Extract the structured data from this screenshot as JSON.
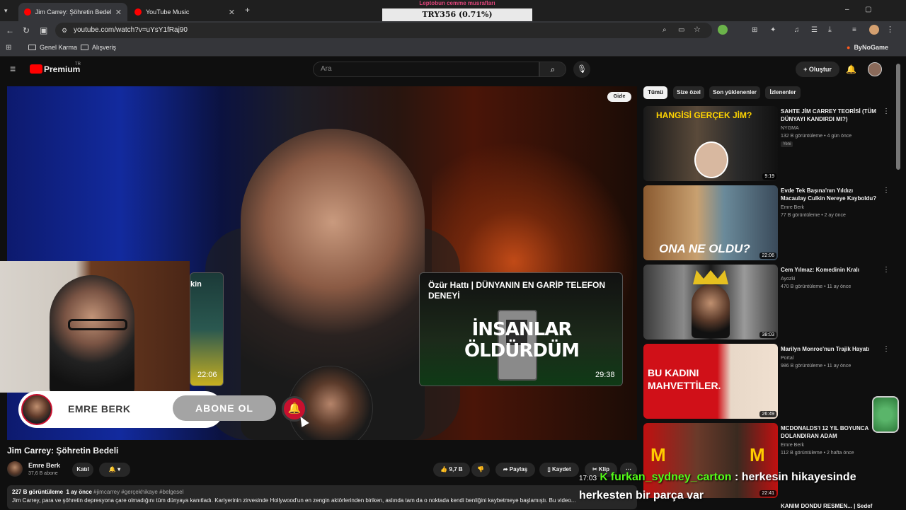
{
  "browser": {
    "tabs": [
      {
        "title": "Jim Carrey: Şöhretin Bedeli - Yo"
      },
      {
        "title": "YouTube Music"
      }
    ],
    "url": "youtube.com/watch?v=uYsY1fRaj90",
    "bookmarks": [
      "Genel Karma",
      "Alışveriş"
    ],
    "extension_label": "ByNoGame"
  },
  "ticker": {
    "header": "Leptobun cemme musrafları",
    "value": "TRY356 (0.71%)"
  },
  "youtube": {
    "logo": "Premium",
    "logo_region": "TR",
    "search_placeholder": "Ara",
    "create_label": "Oluştur"
  },
  "player": {
    "hide_label": "Gizle",
    "endcard_left_title": "kin",
    "endcard_left_duration": "22:06",
    "endcard_right_title": "Özür Hattı | DÜNYANIN EN GARİP TELEFON DENEYİ",
    "endcard_right_text": "İNSANLAR ÖLDÜRDÜM",
    "endcard_right_duration": "29:38",
    "subscribe_channel": "EMRE BERK",
    "subscribe_button": "ABONE OL"
  },
  "video": {
    "title": "Jim Carrey: Şöhretin Bedeli",
    "channel": "Emre Berk",
    "subscribers": "37,6 B abone",
    "join_label": "Katıl",
    "likes": "9,7 B",
    "share_label": "Paylaş",
    "save_label": "Kaydet",
    "clip_label": "Klip",
    "views": "227 B görüntüleme",
    "age": "1 ay önce",
    "hashtags": "#jimcarrey #gerçekhikaye #belgesel",
    "description": "Jim Carrey, para ve şöhretin depresyona çare olmadığını tüm dünyaya kanıtladı. Kariyerinin zirvesinde Hollywood'un en zengin aktörlerinden biriken, aslında tam da o noktada kendi benliğini kaybetmeye başlamıştı. Bu video..."
  },
  "filters": [
    "Tümü",
    "Size özel",
    "Son yüklenenler",
    "İzlenenler"
  ],
  "recommendations": [
    {
      "title": "SAHTE JİM CARREY TEORİSİ (TÜM DÜNYAYI KANDIRDI MI?)",
      "channel": "NYGMA",
      "meta": "132 B görüntüleme • 4 gün önce",
      "badge": "Yeni",
      "duration": "9:19",
      "thumb_text": "HANGİSİ GERÇEK JİM?"
    },
    {
      "title": "Evde Tek Başına'nın Yıldızı Macaulay Culkin Nereye Kayboldu?",
      "channel": "Emre Berk",
      "meta": "77 B görüntüleme • 2 ay önce",
      "duration": "22:06",
      "thumb_text": "ONA NE OLDU?"
    },
    {
      "title": "Cem Yılmaz: Komedinin Kralı",
      "channel": "Ayozki",
      "meta": "470 B görüntüleme • 11 ay önce",
      "duration": "38:03",
      "thumb_text": ""
    },
    {
      "title": "Marilyn Monroe'nun Trajik Hayatı",
      "channel": "Portal",
      "meta": "986 B görüntüleme • 11 ay önce",
      "duration": "26:49",
      "thumb_text": "BU KADINI MAHVETTİLER."
    },
    {
      "title": "MCDONALDS'I 12 YIL BOYUNCA DOLANDIRAN ADAM",
      "channel": "Emre Berk",
      "meta": "112 B görüntüleme • 2 hafta önce",
      "duration": "22:41",
      "thumb_text": ""
    },
    {
      "title": "KANIM DONDU RESMEN... | Sedef",
      "channel": "",
      "meta": "",
      "duration": "",
      "thumb_text": ""
    }
  ],
  "chat": [
    {
      "time": "17:03",
      "user": "furkan_sydney_carton",
      "message": ": herkesin hikayesinde"
    },
    {
      "message": "herkesten bir parça var"
    }
  ]
}
